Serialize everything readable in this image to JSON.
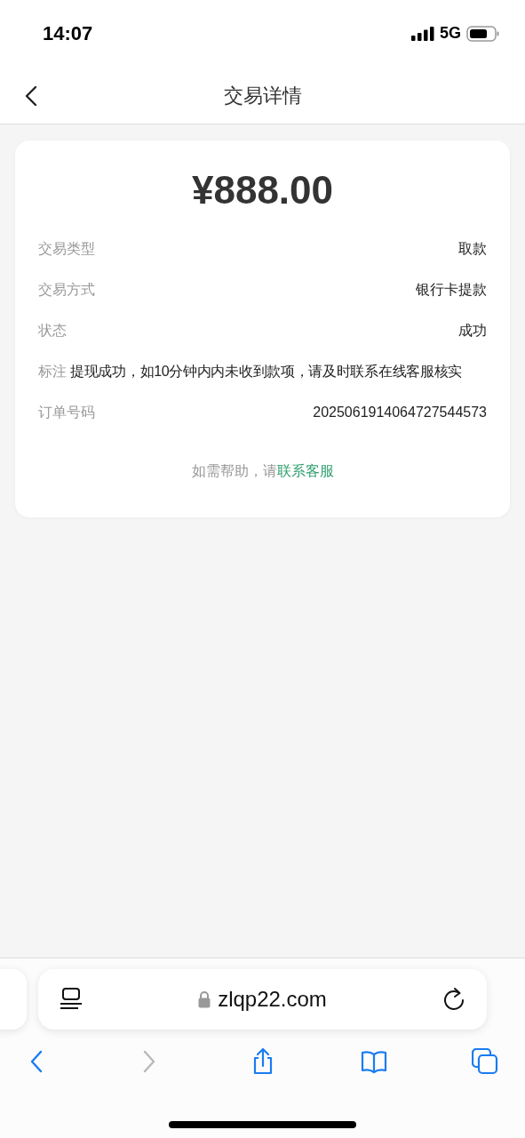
{
  "status_bar": {
    "time": "14:07",
    "network": "5G"
  },
  "nav": {
    "title": "交易详情"
  },
  "amount": "¥888.00",
  "details": [
    {
      "kind": "pair",
      "label": "交易类型",
      "value": "取款"
    },
    {
      "kind": "pair",
      "label": "交易方式",
      "value": "银行卡提款"
    },
    {
      "kind": "pair",
      "label": "状态",
      "value": "成功"
    },
    {
      "kind": "note",
      "label": "标注",
      "value": "提现成功，如10分钟内内未收到款项，请及时联系在线客服核实"
    },
    {
      "kind": "pair",
      "label": "订单号码",
      "value": "2025061914064727544573"
    }
  ],
  "help": {
    "text": "如需帮助，请",
    "link": "联系客服"
  },
  "browser": {
    "url": "zlqp22.com",
    "toolbar": [
      {
        "kind": "back",
        "disabled": false
      },
      {
        "kind": "forward",
        "disabled": true
      },
      {
        "kind": "share",
        "disabled": false
      },
      {
        "kind": "bookmarks",
        "disabled": false
      },
      {
        "kind": "tabs",
        "disabled": false
      }
    ]
  }
}
